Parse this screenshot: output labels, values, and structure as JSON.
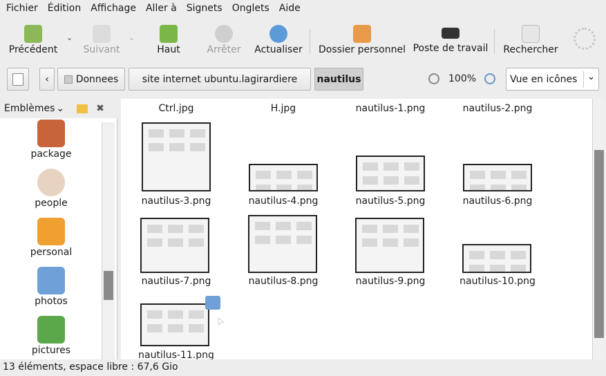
{
  "menubar": {
    "items": [
      "Fichier",
      "Édition",
      "Affichage",
      "Aller à",
      "Signets",
      "Onglets",
      "Aide"
    ]
  },
  "toolbar": {
    "back": "Précédent",
    "forward": "Suivant",
    "up": "Haut",
    "stop": "Arrêter",
    "reload": "Actualiser",
    "home": "Dossier personnel",
    "computer": "Poste de travail",
    "search": "Rechercher"
  },
  "location": {
    "crumbs": [
      "Donnees",
      "site internet ubuntu.lagirardiere",
      "nautilus"
    ],
    "zoom": "100%",
    "view": "Vue en icônes"
  },
  "sidebar": {
    "title": "Emblèmes",
    "items": [
      "package",
      "people",
      "personal",
      "photos",
      "pictures"
    ]
  },
  "files": [
    "Ctrl.jpg",
    "H.jpg",
    "nautilus-1.png",
    "nautilus-2.png",
    "nautilus-3.png",
    "nautilus-4.png",
    "nautilus-5.png",
    "nautilus-6.png",
    "nautilus-7.png",
    "nautilus-8.png",
    "nautilus-9.png",
    "nautilus-10.png",
    "nautilus-11.png"
  ],
  "status": "13 éléments, espace libre : 67,6 Gio"
}
